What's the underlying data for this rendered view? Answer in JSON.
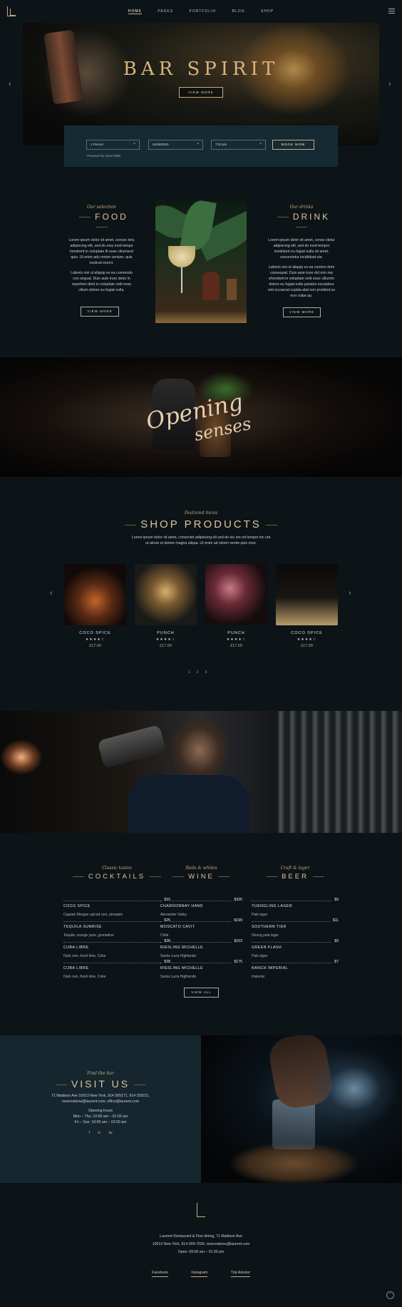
{
  "nav": {
    "items": [
      "HOME",
      "PAGES",
      "PORTFOLIO",
      "BLOG",
      "SHOP"
    ]
  },
  "hero": {
    "title": "BAR SPIRIT",
    "button": "VIEW MORE"
  },
  "booking": {
    "persons": "1 Person",
    "date": "01/09/2020",
    "time": "7:00 pm",
    "button": "BOOK NOW",
    "powered": "*Powered by OpenTable"
  },
  "food": {
    "sub": "Our selection",
    "title": "FOOD",
    "p1": "Lorem ipsum dolor sit amet, consec tetu adipiscing elit, sed do eius mod tempo hendrerit in voluptate lit esse cillumsod quis. Ut enim adu minim veniam, quis nostrud exerci.",
    "p2": "Laboris nisi ut aliquip ex ea commodo con sequat. Duis aute irure dolor in reprehen derit in voluptate velit esse cillum dolore eu fugiat nulla.",
    "button": "VIEW MORE"
  },
  "drink": {
    "sub": "Our drinks",
    "title": "DRINK",
    "p1": "Lorem ipsum dolor sit amet, conse ctetur adipiscing elit, sed do mod tempor incididunt eu fugiat nulla sit amet, consectetur incididunt ute.",
    "p2": "Laboris nisi ut aliquip ex ea commo dom consequat. Duis aute irure dol orin rep ehenderit in voluptate velit esse cillumm dolore eu fugiat nulla pariatur excepteur sint occaecat cupida atat non proident su nun culpa qu.",
    "button": "VIEW MORE"
  },
  "opening": {
    "line1": "Opening",
    "line2": "senses"
  },
  "shop": {
    "sub": "Featured items",
    "title": "SHOP PRODUCTS",
    "desc": "Lorem ipsum dolor sit amet, consectet adipiscing elt sed do eiu sm od tempor inc unt ut abore et dolore magna aliqua. Ut enim ad minim venim quis nost.",
    "products": [
      {
        "name": "COCO SPICE",
        "stars": "★★★★☆",
        "price": "£17.00"
      },
      {
        "name": "PUNCH",
        "stars": "★★★★☆",
        "price": "£17.00"
      },
      {
        "name": "PUNCH",
        "stars": "★★★★☆",
        "price": "£17.00"
      },
      {
        "name": "COCO SPICE",
        "stars": "★★★★☆",
        "price": "£17.00"
      }
    ],
    "dots": [
      "1",
      "2",
      "3"
    ]
  },
  "menu": {
    "cocktails": {
      "sub": "Classic tastes",
      "title": "COCKTAILS",
      "items": [
        {
          "name": "COCO SPICE",
          "price": "$32",
          "desc": "Captain Morgan spiced rum, pineaple"
        },
        {
          "name": "TEQUILA SUNRISE",
          "price": "$25",
          "desc": "Tequila, orange juice, grenadine"
        },
        {
          "name": "CUBA LIBRE",
          "price": "$38",
          "desc": "Dark rum, fresh lime, Coke"
        },
        {
          "name": "CUBA LIBRE",
          "price": "$38",
          "desc": "Dark rum, fresh lime, Coke"
        }
      ]
    },
    "wine": {
      "sub": "Reds & whites",
      "title": "WINE",
      "items": [
        {
          "name": "CHARDONNAY HAND",
          "price": "$326",
          "desc": "Alexander Valley"
        },
        {
          "name": "MOSCATO CAVIT",
          "price": "$199",
          "desc": "Chile"
        },
        {
          "name": "RIESLING MICHELLE",
          "price": "$163",
          "desc": "Santa Lucia Highlands"
        },
        {
          "name": "RIESLING MICHELLE",
          "price": "$175",
          "desc": "Santa Lucia Highlands"
        }
      ]
    },
    "beer": {
      "sub": "Craft & lager",
      "title": "BEER",
      "items": [
        {
          "name": "YUENGLING LAGER",
          "price": "$9",
          "desc": "Pale lager"
        },
        {
          "name": "SOUTHERN TIER",
          "price": "$11",
          "desc": "Strong pale lager"
        },
        {
          "name": "GREEN FLASH",
          "price": "$9",
          "desc": "Pale lager"
        },
        {
          "name": "RANCH IMPERIAL",
          "price": "$7",
          "desc": "Imperial"
        }
      ]
    },
    "button": "VIEW ALL"
  },
  "visit": {
    "sub": "Find the bar",
    "title": "VISIT US",
    "addr": "71 Madison Ave 10013 New York, 914 309171, 914 329211,",
    "email": "reservations@laurent.com, office@laurent.com",
    "hours_title": "Opening hours",
    "hours1": "Mon – Thu: 10:00 am – 01:00 am",
    "hours2": "Fri – Sun: 10:00 am – 02:00 am",
    "social": [
      "f",
      "in",
      "tw"
    ]
  },
  "footer": {
    "line1": "Laurent Restaurant & Fine dining, 71 Madison Ave",
    "line2": "10013 New York, 914-309-7030, reservations@laurent.com",
    "line3": "Open: 09:00 am – 01:00 pm",
    "links": [
      "Facebook",
      "Instagram",
      "Trip Advisor"
    ]
  }
}
